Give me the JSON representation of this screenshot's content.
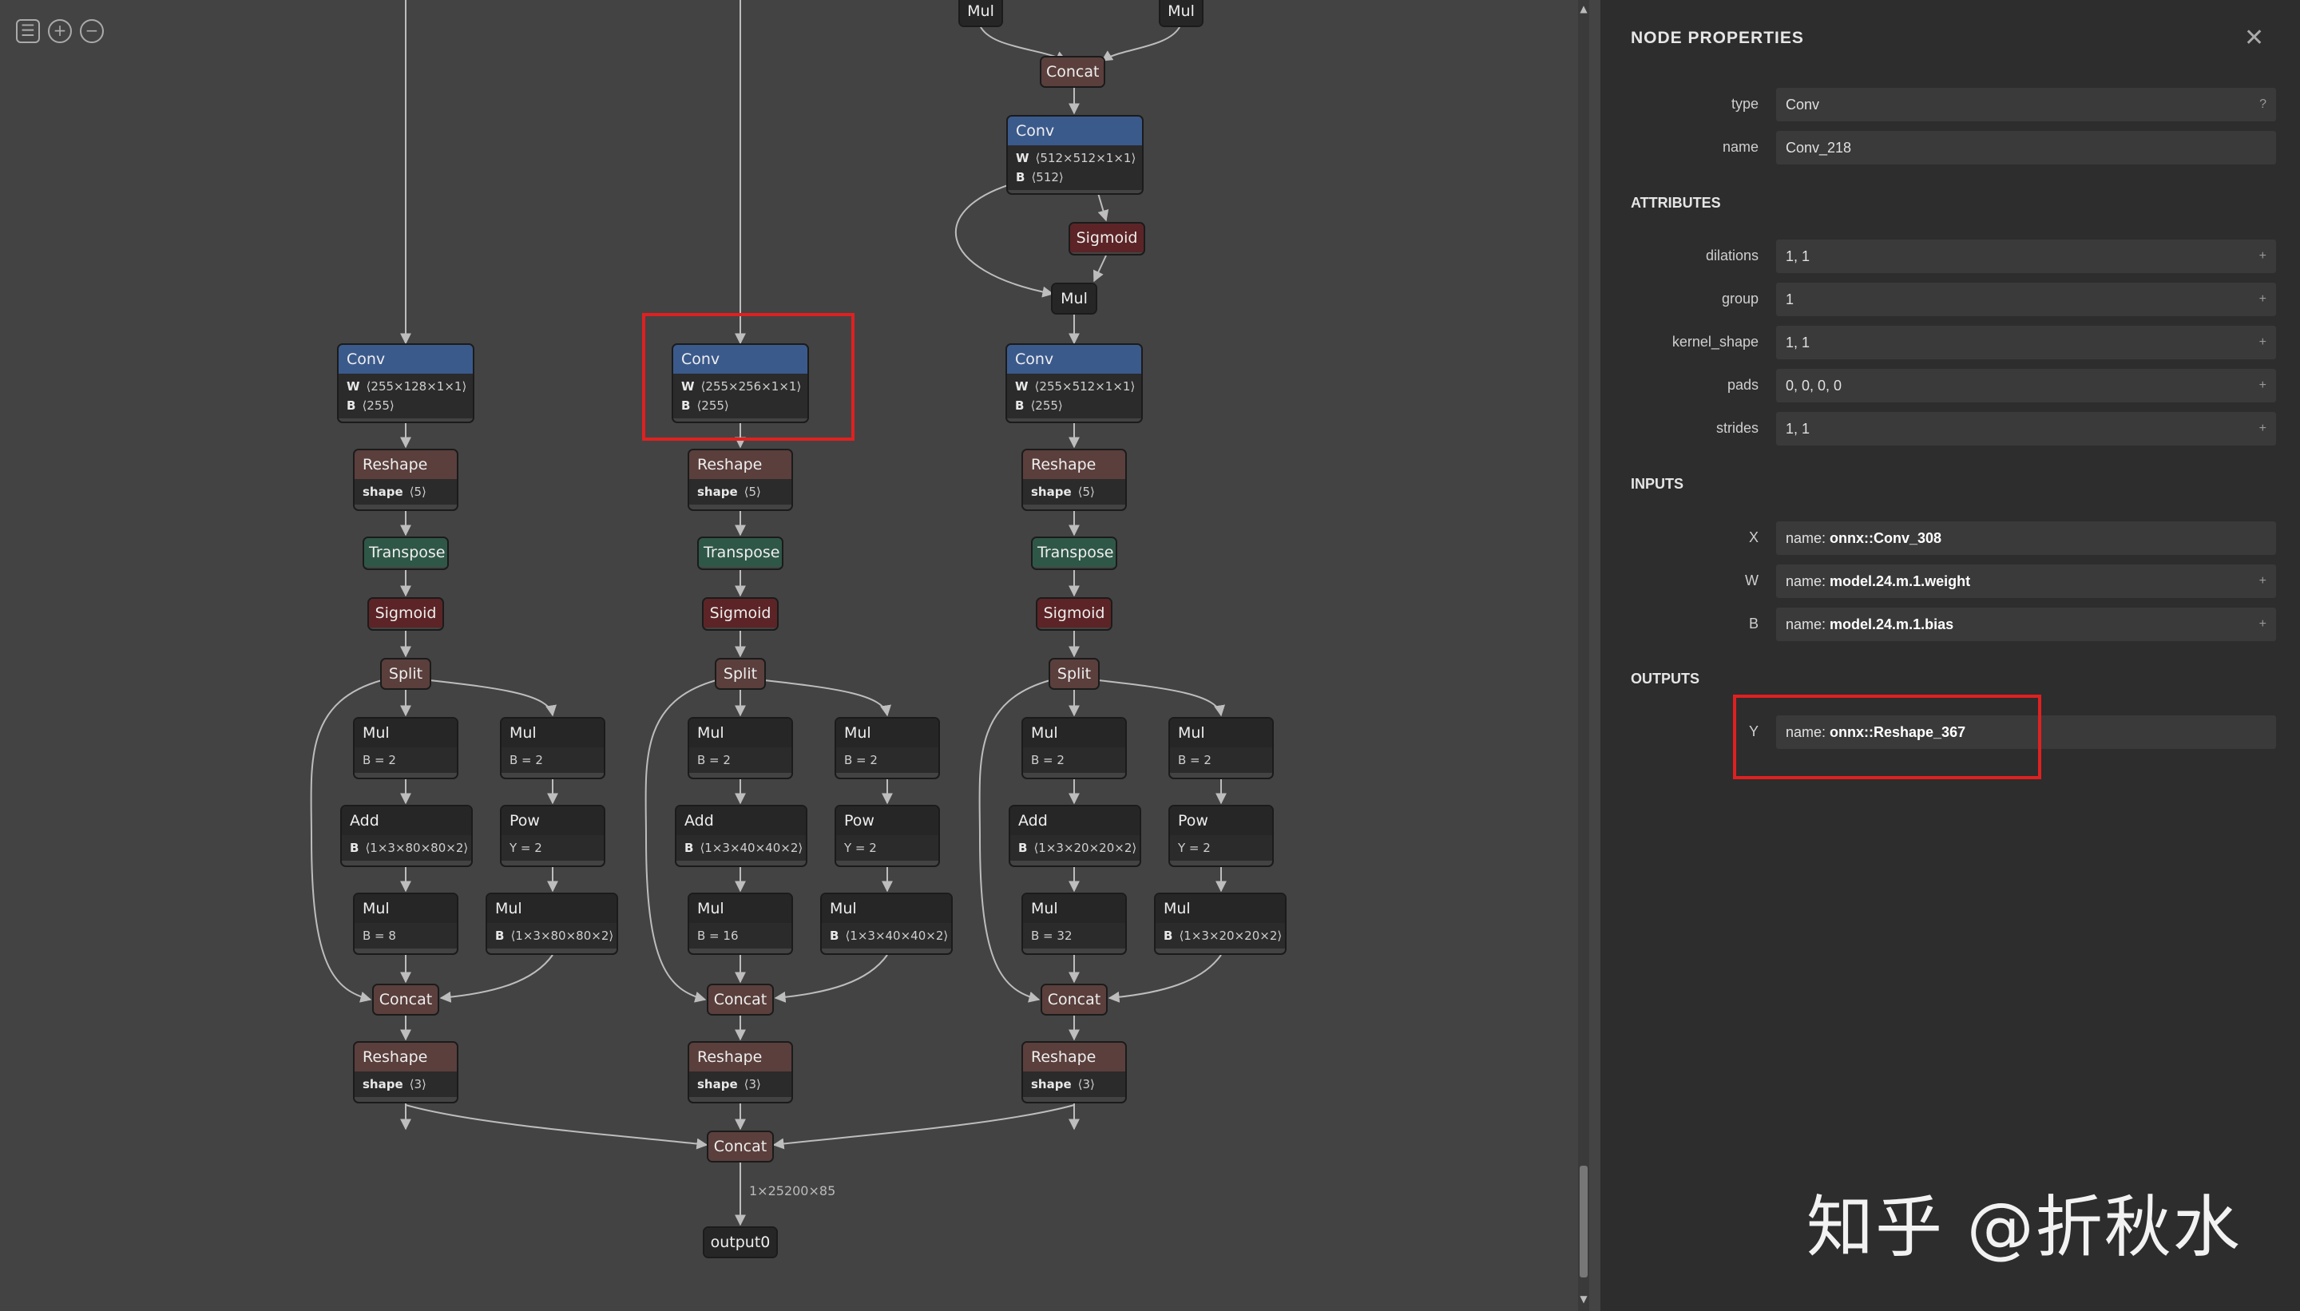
{
  "toolbar": {
    "menu_icon": "menu-icon",
    "zoom_in_icon": "zoom-in-icon",
    "zoom_out_icon": "zoom-out-icon"
  },
  "graph": {
    "top": {
      "mul_left": "Mul",
      "mul_right": "Mul",
      "concat": "Concat"
    },
    "branch3_top": {
      "conv": {
        "op": "Conv",
        "w": "⟨512×512×1×1⟩",
        "b": "⟨512⟩"
      },
      "sigmoid": "Sigmoid",
      "mul": "Mul"
    },
    "columns": [
      {
        "conv": {
          "op": "Conv",
          "w": "⟨255×128×1×1⟩",
          "b": "⟨255⟩"
        },
        "reshape1": {
          "op": "Reshape",
          "shape": "⟨5⟩"
        },
        "transpose": "Transpose",
        "sigmoid": "Sigmoid",
        "split": "Split",
        "mul_a": {
          "op": "Mul",
          "attr": "B = 2"
        },
        "mul_b": {
          "op": "Mul",
          "attr": "B = 2"
        },
        "add": {
          "op": "Add",
          "attr": "⟨1×3×80×80×2⟩"
        },
        "pow": {
          "op": "Pow",
          "attr": "Y = 2"
        },
        "mul_c": {
          "op": "Mul",
          "attr": "B = 8"
        },
        "mul_d": {
          "op": "Mul",
          "attr": "⟨1×3×80×80×2⟩"
        },
        "concat": "Concat",
        "reshape2": {
          "op": "Reshape",
          "shape": "⟨3⟩"
        }
      },
      {
        "conv": {
          "op": "Conv",
          "w": "⟨255×256×1×1⟩",
          "b": "⟨255⟩"
        },
        "reshape1": {
          "op": "Reshape",
          "shape": "⟨5⟩"
        },
        "transpose": "Transpose",
        "sigmoid": "Sigmoid",
        "split": "Split",
        "mul_a": {
          "op": "Mul",
          "attr": "B = 2"
        },
        "mul_b": {
          "op": "Mul",
          "attr": "B = 2"
        },
        "add": {
          "op": "Add",
          "attr": "⟨1×3×40×40×2⟩"
        },
        "pow": {
          "op": "Pow",
          "attr": "Y = 2"
        },
        "mul_c": {
          "op": "Mul",
          "attr": "B = 16"
        },
        "mul_d": {
          "op": "Mul",
          "attr": "⟨1×3×40×40×2⟩"
        },
        "concat": "Concat",
        "reshape2": {
          "op": "Reshape",
          "shape": "⟨3⟩"
        }
      },
      {
        "conv": {
          "op": "Conv",
          "w": "⟨255×512×1×1⟩",
          "b": "⟨255⟩"
        },
        "reshape1": {
          "op": "Reshape",
          "shape": "⟨5⟩"
        },
        "transpose": "Transpose",
        "sigmoid": "Sigmoid",
        "split": "Split",
        "mul_a": {
          "op": "Mul",
          "attr": "B = 2"
        },
        "mul_b": {
          "op": "Mul",
          "attr": "B = 2"
        },
        "add": {
          "op": "Add",
          "attr": "⟨1×3×20×20×2⟩"
        },
        "pow": {
          "op": "Pow",
          "attr": "Y = 2"
        },
        "mul_c": {
          "op": "Mul",
          "attr": "B = 32"
        },
        "mul_d": {
          "op": "Mul",
          "attr": "⟨1×3×20×20×2⟩"
        },
        "concat": "Concat",
        "reshape2": {
          "op": "Reshape",
          "shape": "⟨3⟩"
        }
      }
    ],
    "labels": {
      "w": "W",
      "b": "B",
      "shape": "shape"
    },
    "final_concat": "Concat",
    "output_shape": "1×25200×85",
    "output": "output0"
  },
  "panel": {
    "title": "NODE PROPERTIES",
    "close_icon": "close-icon",
    "type_label": "type",
    "type_value": "Conv",
    "type_help": "?",
    "name_label": "name",
    "name_value": "Conv_218",
    "attributes_title": "ATTRIBUTES",
    "attributes": [
      {
        "label": "dilations",
        "value": "1, 1"
      },
      {
        "label": "group",
        "value": "1"
      },
      {
        "label": "kernel_shape",
        "value": "1, 1"
      },
      {
        "label": "pads",
        "value": "0, 0, 0, 0"
      },
      {
        "label": "strides",
        "value": "1, 1"
      }
    ],
    "expand_glyph": "+",
    "inputs_title": "INPUTS",
    "inputs": [
      {
        "label": "X",
        "prefix": "name: ",
        "value": "onnx::Conv_308"
      },
      {
        "label": "W",
        "prefix": "name: ",
        "value": "model.24.m.1.weight"
      },
      {
        "label": "B",
        "prefix": "name: ",
        "value": "model.24.m.1.bias"
      }
    ],
    "outputs_title": "OUTPUTS",
    "outputs": [
      {
        "label": "Y",
        "prefix": "name: ",
        "value": "onnx::Reshape_367"
      }
    ]
  },
  "watermark": "知乎 @折秋水"
}
